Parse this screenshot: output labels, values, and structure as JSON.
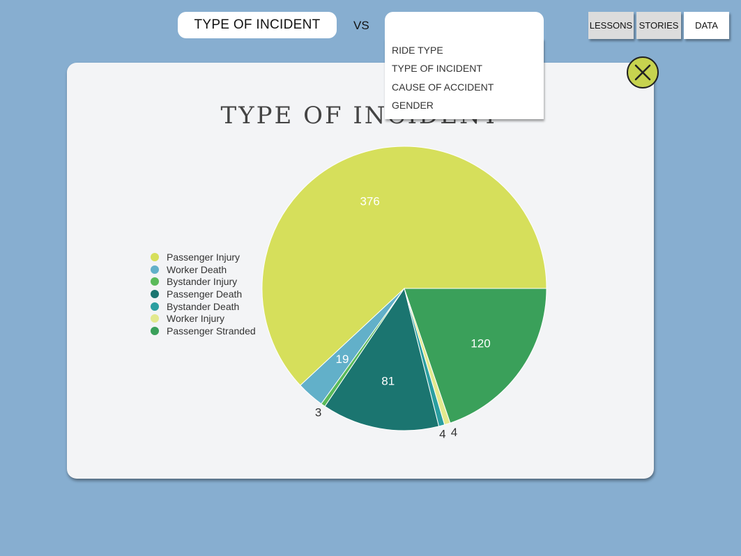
{
  "header": {
    "primary_selection": "TYPE OF INCIDENT",
    "vs_label": "VS",
    "secondary_selection": "",
    "dropdown_options": [
      "RIDE TYPE",
      "TYPE OF INCIDENT",
      "CAUSE OF ACCIDENT",
      "GENDER"
    ]
  },
  "nav": {
    "lessons": "LESSONS",
    "stories": "STORIES",
    "data": "DATA"
  },
  "close_icon": "close-x-icon",
  "colors": {
    "background": "#87aed0",
    "close_button": "#c7d34f"
  },
  "chart_data": {
    "type": "pie",
    "title": "TYPE OF INCIDENT",
    "categories": [
      "Passenger Injury",
      "Worker Death",
      "Bystander Injury",
      "Passenger Death",
      "Bystander Death",
      "Worker Injury",
      "Passenger Stranded"
    ],
    "values": [
      376,
      19,
      3,
      81,
      4,
      4,
      120
    ],
    "colors": [
      "#d6df5b",
      "#62b0c9",
      "#5aba5a",
      "#1b7570",
      "#2a9ea0",
      "#e3e98e",
      "#3aa05a"
    ],
    "legend_position": "left"
  }
}
